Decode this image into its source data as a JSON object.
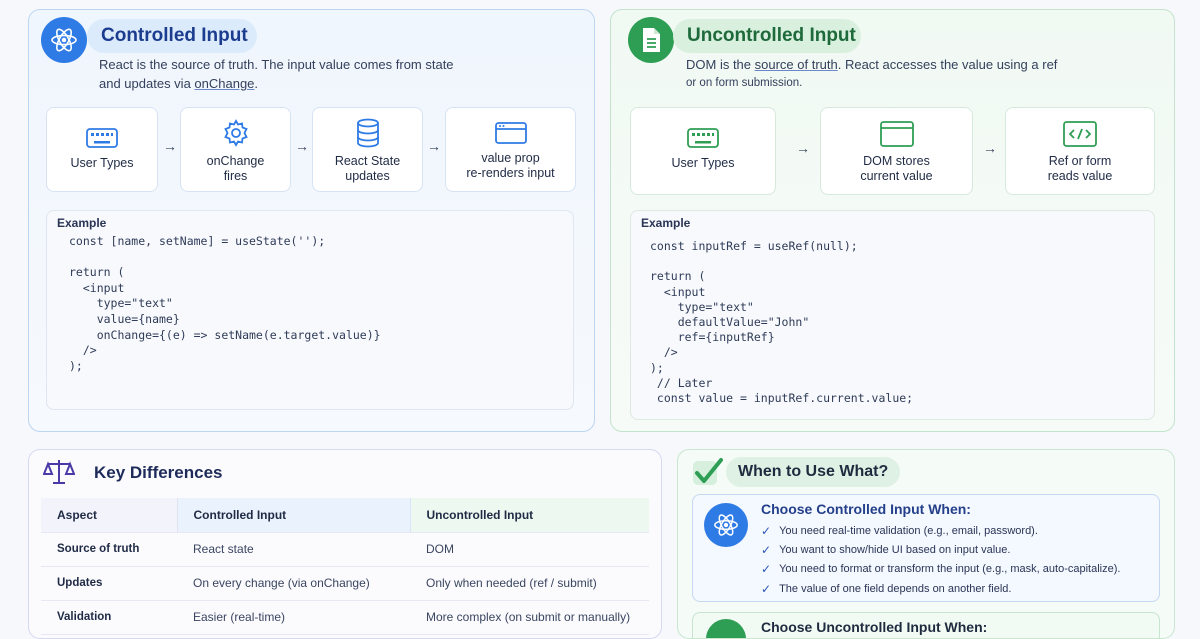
{
  "controlled": {
    "title": "Controlled Input",
    "desc_line1": "React is the source of truth. The input value comes from state",
    "desc_line2_prefix": "and updates via ",
    "desc_line2_link": "onChange",
    "desc_line2_suffix": ".",
    "steps": [
      {
        "line1": "User Types",
        "line2": "",
        "icon": "keyboard-icon"
      },
      {
        "line1": "onChange",
        "line2": "fires",
        "icon": "gear-icon"
      },
      {
        "line1": "React State",
        "line2": "updates",
        "icon": "database-icon"
      },
      {
        "line1": "value prop",
        "line2": "re-renders input",
        "icon": "browser-window-icon"
      }
    ],
    "example_label": "Example",
    "code": [
      "const [name, setName] = useState('');",
      "",
      "return (",
      "  <input",
      "    type=\"text\"",
      "    value={name}",
      "    onChange={(e) => setName(e.target.value)}",
      "  />",
      ");"
    ]
  },
  "uncontrolled": {
    "title": "Uncontrolled Input",
    "desc_line1_prefix": "DOM is the ",
    "desc_line1_hl": "source of truth",
    "desc_line1_suffix": ". React accesses the value using a ref",
    "desc_line2": "or on form submission.",
    "steps": [
      {
        "line1": "User Types",
        "line2": "",
        "icon": "keyboard-icon"
      },
      {
        "line1": "DOM stores",
        "line2": "current value",
        "icon": "browser-window-icon"
      },
      {
        "line1": "Ref or form",
        "line2": "reads value",
        "icon": "code-icon"
      }
    ],
    "example_label": "Example",
    "code": [
      "const inputRef = useRef(null);",
      "",
      "return (",
      "  <input",
      "    type=\"text\"",
      "    defaultValue=\"John\"",
      "    ref={inputRef}",
      "  />",
      ");",
      " // Later",
      " const value = inputRef.current.value;"
    ]
  },
  "differences": {
    "title": "Key Differences",
    "headers": [
      "Aspect",
      "Controlled Input",
      "Uncontrolled Input"
    ],
    "rows": [
      [
        "Source of truth",
        "React state",
        "DOM"
      ],
      [
        "Updates",
        "On every change (via onChange)",
        "Only when needed (ref / submit)"
      ],
      [
        "Validation",
        "Easier (real-time)",
        "More complex (on submit or manually)"
      ]
    ]
  },
  "when": {
    "title": "When to Use What?",
    "controlled_title": "Choose Controlled Input When:",
    "controlled_items": [
      "You need real-time validation (e.g., email, password).",
      "You want to show/hide UI based on input value.",
      "You need to format or transform the input (e.g., mask, auto-capitalize).",
      "The value of one field depends on another field."
    ],
    "uncontrolled_title": "Choose Uncontrolled Input When:"
  },
  "colors": {
    "controlled_accent": "#2f7be5",
    "uncontrolled_accent": "#2f9e55",
    "differences_accent": "#4a3aa8",
    "controlled_title_text": "#1c3d8f",
    "uncontrolled_title_text": "#1e6a3a"
  }
}
